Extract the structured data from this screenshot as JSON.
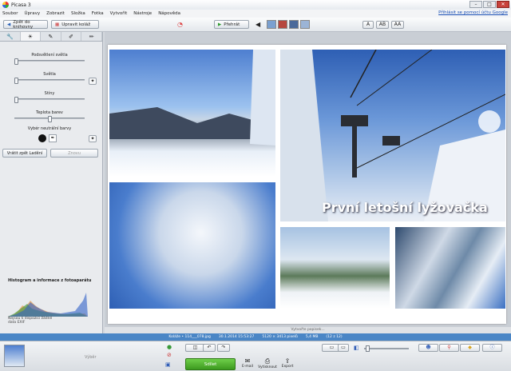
{
  "window": {
    "title": "Picasa 3"
  },
  "menu": {
    "items": [
      "Soubor",
      "Úpravy",
      "Zobrazit",
      "Složka",
      "Fotka",
      "Vytvořit",
      "Nástroje",
      "Nápověda"
    ],
    "help_link": "Přihlásit se pomocí účtu Google"
  },
  "toolbar": {
    "back_label": "Zpět do knihovny",
    "undo_label": "Upravit koláž",
    "play_label": "Přehrát",
    "text_size_buttons": [
      "A",
      "AB",
      "AA"
    ]
  },
  "edit_panel": {
    "tabs": [
      "wrench-icon",
      "sun-icon",
      "brush-icon",
      "paint-icon",
      "pen-icon"
    ],
    "sliders": [
      {
        "label": "Podsvětlení světla",
        "level": 0.05
      },
      {
        "label": "Světla",
        "level": 0.05
      },
      {
        "label": "Stíny",
        "level": 0.05
      },
      {
        "label": "Teplota barev",
        "level": 0.5
      }
    ],
    "neutral_color_label": "Vybér neutrální barvy",
    "undo_all_label": "Vrátit zpět Ladění",
    "redo_label": "Znovu",
    "histogram_title": "Histogram a informace z fotoaparátu",
    "camera_info": "Nejsou k dispozici žádné data EXIF"
  },
  "collage": {
    "title": "První letošní lyžovačka"
  },
  "statusbar": {
    "text": "Vytvořte popisek..."
  },
  "infobar": {
    "parts": [
      "Koláže • 114___078.jpg",
      "30.1.2014 15:53:27",
      "5120 × 3413 pixelů",
      "5,4 MB",
      "(12 z 12)"
    ]
  },
  "tray": {
    "selection_label": "Výběr",
    "share_label": "Sdílet",
    "actions": [
      {
        "label": "E-mail",
        "icon": "mail-icon"
      },
      {
        "label": "Vytisknout",
        "icon": "printer-icon"
      },
      {
        "label": "Export",
        "icon": "export-icon"
      }
    ]
  },
  "colors": {
    "accent": "#4a86c6",
    "share_green": "#4caf2f"
  }
}
